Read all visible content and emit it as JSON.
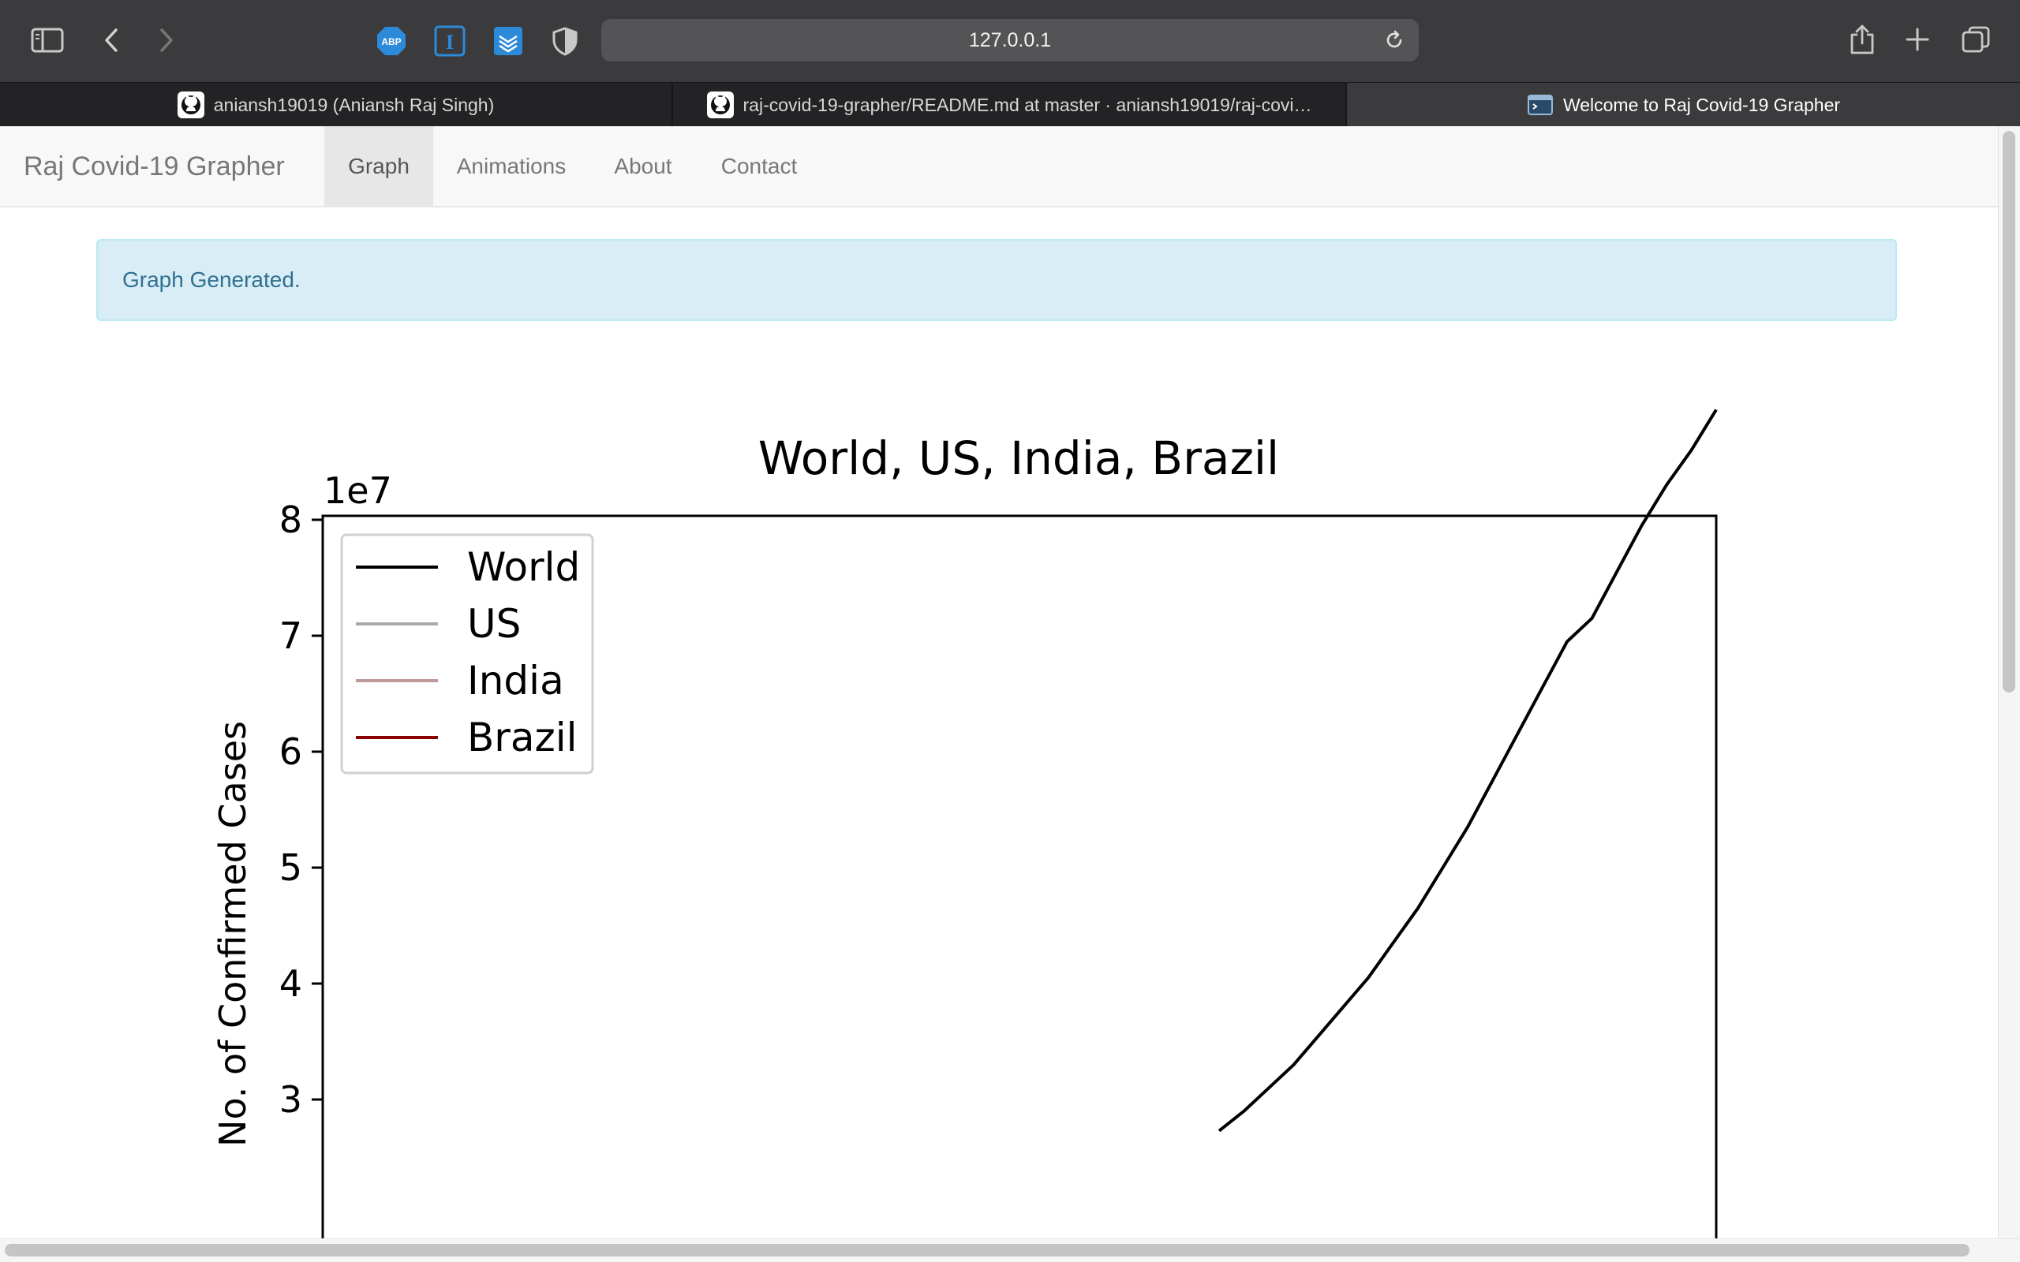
{
  "browser": {
    "url": "127.0.0.1",
    "tabs": [
      {
        "title": "aniansh19019 (Aniansh Raj Singh)",
        "icon": "github-icon",
        "active": false
      },
      {
        "title": "raj-covid-19-grapher/README.md at master · aniansh19019/raj-covi…",
        "icon": "github-icon",
        "active": false
      },
      {
        "title": "Welcome to Raj Covid-19 Grapher",
        "icon": "terminal-window-icon",
        "active": true
      }
    ],
    "extensions": [
      "adblock-plus-icon",
      "instapaper-icon",
      "stacks-icon",
      "privacy-shield-icon"
    ]
  },
  "navbar": {
    "brand": "Raj Covid-19 Grapher",
    "links": [
      "Graph",
      "Animations",
      "About",
      "Contact"
    ],
    "active": "Graph"
  },
  "alert": {
    "text": "Graph Generated."
  },
  "chart_data": {
    "type": "line",
    "title": "World, US, India, Brazil",
    "ylabel": "No. of Confirmed Cases",
    "y_offset_label": "1e7",
    "y_ticks": [
      3,
      4,
      5,
      6,
      7,
      8
    ],
    "legend": [
      "World",
      "US",
      "India",
      "Brazil"
    ],
    "legend_position": "upper-left",
    "colors": {
      "World": "#000000",
      "US": "#aaaaaa",
      "India": "#c09a9a",
      "Brazil": "#8b0000"
    },
    "series": [
      {
        "name": "World",
        "values_1e7": [
          2.73,
          2.9,
          3.1,
          3.3,
          3.55,
          3.8,
          4.05,
          4.35,
          4.65,
          5.0,
          5.35,
          5.75,
          6.15,
          6.55,
          6.95,
          7.15,
          7.55,
          7.95,
          8.3,
          8.6,
          8.95
        ]
      }
    ]
  }
}
